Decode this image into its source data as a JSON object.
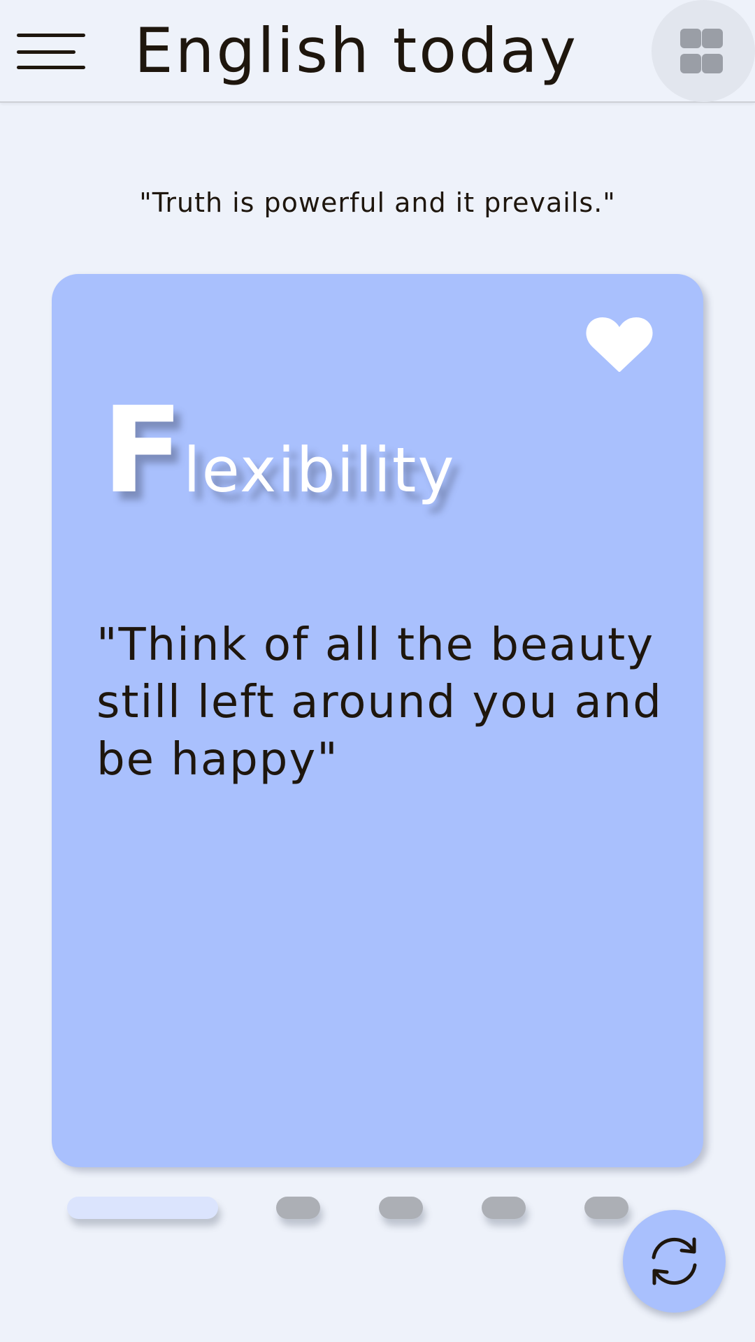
{
  "app_bar": {
    "title": "English today",
    "menu_icon": "hamburger-menu-icon",
    "grid_icon": "grid-view-icon"
  },
  "daily_quote": "\"Truth is powerful and it prevails.\"",
  "card": {
    "word_first_letter": "F",
    "word_rest": "lexibility",
    "quote": "\"Think of all the beauty still left around you and be happy\"",
    "favorite_icon": "heart-icon",
    "background_color": "#a9c0fd"
  },
  "pager": {
    "total_pages": 5,
    "current_page": 1,
    "active_color": "#dbe4fd",
    "inactive_color": "#acafb5"
  },
  "refresh_button": {
    "icon": "refresh-icon"
  },
  "colors": {
    "background": "#eef2fa",
    "accent": "#a9c0fd",
    "text": "#1e160d"
  }
}
